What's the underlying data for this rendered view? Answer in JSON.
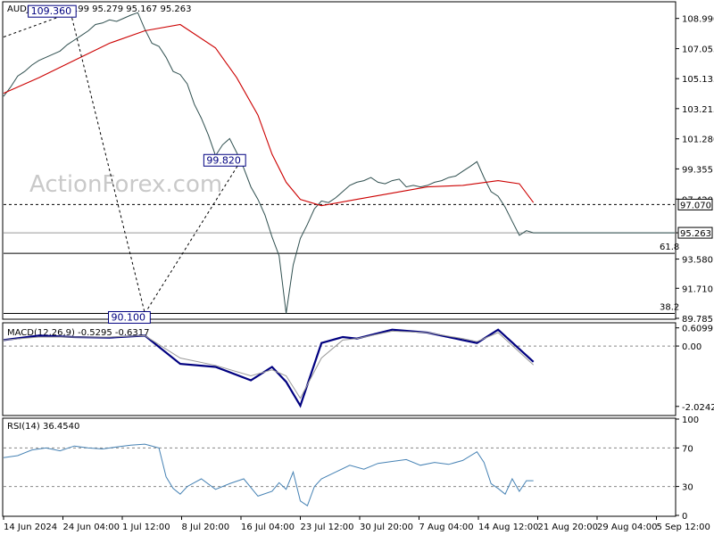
{
  "watermark": "ActionForex.com",
  "chart_data": [
    {
      "type": "line",
      "title": "AUDJPY,H4  95.199 95.279 95.167 95.263",
      "ylim": [
        89.785,
        110.0
      ],
      "yticks": [
        "108.990",
        "107.055",
        "105.135",
        "103.215",
        "101.280",
        "99.355",
        "97.420",
        "95.263",
        "93.580",
        "91.710",
        "89.785"
      ],
      "series": [
        {
          "name": "",
          "role": "price",
          "color": "#2f4f4f",
          "x": [
            0,
            2,
            4,
            6,
            8,
            10,
            12,
            14,
            16,
            18,
            20,
            22,
            24,
            26,
            28,
            30,
            32,
            34,
            36,
            38,
            40,
            42,
            44,
            46,
            48,
            50,
            52,
            54,
            56,
            58,
            60,
            62,
            64,
            66,
            68,
            70,
            72,
            74,
            76,
            78,
            80,
            82,
            84,
            86,
            88,
            90,
            92,
            94,
            96,
            98,
            100,
            102,
            104,
            106,
            108,
            110,
            112,
            114,
            116,
            118,
            120,
            122,
            124,
            126,
            128,
            130,
            132,
            134,
            136,
            138,
            140,
            142,
            144,
            146,
            148,
            150,
            152,
            154,
            156,
            158,
            160,
            162,
            164,
            166,
            168,
            170,
            172,
            174,
            176,
            178,
            180,
            182,
            184,
            186,
            188,
            190
          ],
          "y": [
            104.0,
            104.6,
            105.3,
            105.6,
            106.0,
            106.3,
            106.5,
            106.7,
            106.9,
            107.3,
            107.6,
            107.9,
            108.2,
            108.6,
            108.7,
            108.9,
            108.8,
            109.0,
            109.2,
            109.36,
            108.3,
            107.4,
            107.2,
            106.5,
            105.6,
            105.4,
            104.8,
            103.5,
            102.6,
            101.5,
            100.2,
            100.9,
            101.3,
            100.4,
            99.4,
            98.2,
            97.4,
            96.4,
            95.0,
            93.8,
            90.1,
            93.2,
            94.9,
            95.8,
            96.8,
            97.3,
            97.2,
            97.5,
            97.9,
            98.3,
            98.5,
            98.6,
            98.8,
            98.5,
            98.4,
            98.6,
            98.7,
            98.2,
            98.3,
            98.2,
            98.3,
            98.5,
            98.6,
            98.8,
            98.9,
            99.2,
            99.5,
            99.82,
            98.8,
            97.9,
            97.6,
            96.9,
            96.0,
            95.1,
            95.4,
            95.263,
            95.263,
            95.263,
            95.263,
            95.263,
            95.263,
            95.263,
            95.263,
            95.263,
            95.263,
            95.263,
            95.263,
            95.263,
            95.263,
            95.263,
            95.263,
            95.263,
            95.263,
            95.263,
            95.263,
            95.263
          ]
        },
        {
          "name": "",
          "role": "moving-average",
          "color": "#cc0000",
          "x": [
            0,
            10,
            20,
            30,
            40,
            50,
            60,
            66,
            72,
            76,
            80,
            84,
            90,
            100,
            110,
            120,
            130,
            140,
            146,
            150
          ],
          "y": [
            104.2,
            105.2,
            106.3,
            107.4,
            108.2,
            108.6,
            107.1,
            105.2,
            102.8,
            100.3,
            98.5,
            97.4,
            97.0,
            97.4,
            97.8,
            98.2,
            98.3,
            98.6,
            98.4,
            97.2
          ]
        }
      ],
      "hlines": [
        {
          "value": 97.07,
          "label": "97.070",
          "style": "dashed"
        },
        {
          "value": 95.263,
          "label": "95.263",
          "style": "solid-light"
        },
        {
          "value": 93.95,
          "label": "61.8",
          "style": "solid"
        },
        {
          "value": 90.1,
          "label": "38.2",
          "style": "solid"
        }
      ],
      "annotations": [
        {
          "label": "109.360",
          "x": 19,
          "y": 109.36
        },
        {
          "label": "99.820",
          "x": 67,
          "y": 99.82
        },
        {
          "label": "90.100",
          "x": 40,
          "y": 90.1
        }
      ]
    },
    {
      "type": "line",
      "title": "MACD(12,26,9) -0.5295 -0.6317",
      "ylim": [
        -2.3,
        0.75
      ],
      "yticks": [
        "0.6099",
        "0.00",
        "-2.0242"
      ],
      "series": [
        {
          "name": "",
          "role": "macd",
          "color": "#000080",
          "x": [
            0,
            10,
            20,
            30,
            40,
            50,
            60,
            70,
            76,
            80,
            84,
            90,
            96,
            100,
            110,
            120,
            130,
            134,
            140,
            150
          ],
          "y": [
            0.2,
            0.35,
            0.3,
            0.28,
            0.35,
            -0.6,
            -0.7,
            -1.15,
            -0.7,
            -1.2,
            -2.0,
            0.1,
            0.3,
            0.25,
            0.55,
            0.45,
            0.2,
            0.1,
            0.55,
            -0.53
          ]
        },
        {
          "name": "",
          "role": "signal",
          "color": "#999999",
          "x": [
            0,
            10,
            20,
            30,
            40,
            50,
            60,
            70,
            76,
            80,
            84,
            90,
            96,
            100,
            110,
            120,
            130,
            134,
            140,
            150
          ],
          "y": [
            0.2,
            0.3,
            0.3,
            0.3,
            0.35,
            -0.4,
            -0.65,
            -1.0,
            -0.8,
            -1.0,
            -1.75,
            -0.4,
            0.2,
            0.25,
            0.5,
            0.45,
            0.25,
            0.15,
            0.45,
            -0.63
          ]
        }
      ]
    },
    {
      "type": "line",
      "title": "RSI(14) 36.4540",
      "ylim": [
        0,
        100
      ],
      "yticks": [
        "100",
        "70",
        "30",
        "0"
      ],
      "series": [
        {
          "name": "",
          "role": "rsi",
          "color": "#4682b4",
          "x": [
            0,
            4,
            8,
            12,
            16,
            20,
            24,
            28,
            32,
            36,
            40,
            44,
            46,
            48,
            50,
            52,
            56,
            60,
            64,
            68,
            72,
            76,
            78,
            80,
            82,
            84,
            86,
            88,
            90,
            94,
            98,
            102,
            106,
            110,
            114,
            118,
            122,
            126,
            130,
            134,
            136,
            138,
            140,
            142,
            144,
            146,
            148,
            150
          ],
          "y": [
            60,
            62,
            68,
            70,
            67,
            72,
            70,
            69,
            71,
            73,
            74,
            70,
            40,
            28,
            22,
            30,
            38,
            27,
            33,
            38,
            20,
            25,
            34,
            27,
            45,
            15,
            10,
            30,
            38,
            45,
            52,
            48,
            54,
            56,
            58,
            52,
            55,
            53,
            57,
            66,
            55,
            33,
            28,
            22,
            38,
            25,
            36,
            36
          ]
        }
      ]
    }
  ],
  "x_labels": [
    "14 Jun 2024",
    "24 Jun 04:00",
    "1 Jul 12:00",
    "8 Jul 20:00",
    "16 Jul 04:00",
    "23 Jul 12:00",
    "30 Jul 20:00",
    "7 Aug 04:00",
    "14 Aug 12:00",
    "21 Aug 20:00",
    "29 Aug 04:00",
    "5 Sep 12:00"
  ]
}
